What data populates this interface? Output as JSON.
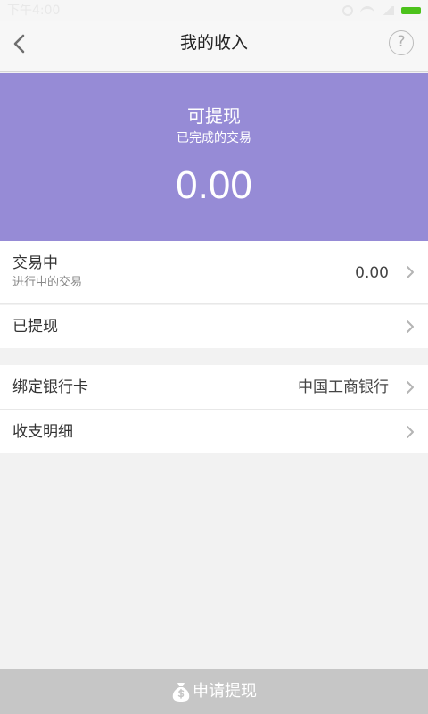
{
  "status_bar": {
    "time": "下午4:00"
  },
  "nav": {
    "title": "我的收入",
    "help_glyph": "?"
  },
  "balance": {
    "title": "可提现",
    "subtitle": "已完成的交易",
    "amount": "0.00"
  },
  "rows": [
    {
      "label": "交易中",
      "sub": "进行中的交易",
      "value": "0.00"
    },
    {
      "label": "已提现"
    },
    {
      "label": "绑定银行卡",
      "value": "中国工商银行"
    },
    {
      "label": "收支明细"
    }
  ],
  "footer": {
    "label": "申请提现"
  },
  "icons": [
    "back-arrow-icon",
    "help-icon",
    "chevron-right-icon",
    "money-bag-icon",
    "alarm-icon",
    "wifi-icon",
    "signal-icon",
    "battery-icon"
  ],
  "colors": {
    "hero_bg": "#968bd6",
    "footer_bg": "#c6c6c6",
    "battery": "#4cc21b"
  }
}
